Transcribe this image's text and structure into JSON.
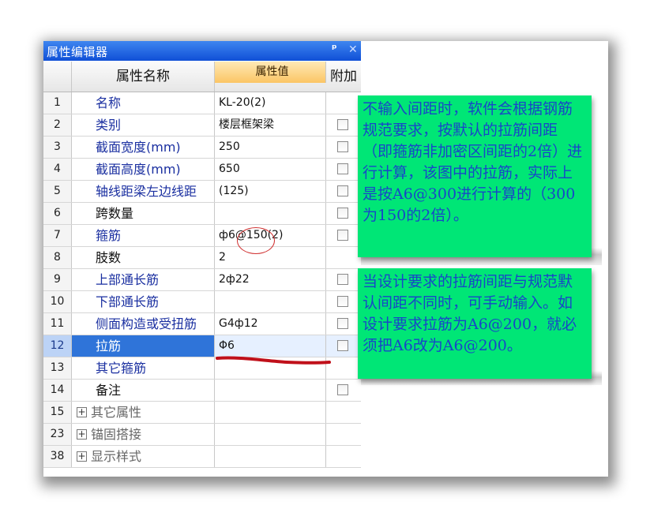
{
  "window": {
    "title": "属性编辑器",
    "pin_icon": "pin-icon",
    "close_icon": "close-icon"
  },
  "headers": {
    "name": "属性名称",
    "value": "属性值",
    "add": "附加"
  },
  "rows": [
    {
      "num": "1",
      "name": "名称",
      "value": "KL-20(2)",
      "checkbox": false
    },
    {
      "num": "2",
      "name": "类别",
      "value": "楼层框架梁",
      "checkbox": true
    },
    {
      "num": "3",
      "name": "截面宽度(mm)",
      "value": "250",
      "checkbox": true
    },
    {
      "num": "4",
      "name": "截面高度(mm)",
      "value": "650",
      "checkbox": true
    },
    {
      "num": "5",
      "name": "轴线距梁左边线距",
      "value": "(125)",
      "checkbox": true
    },
    {
      "num": "6",
      "name": "跨数量",
      "value": "",
      "checkbox": true
    },
    {
      "num": "7",
      "name": "箍筋",
      "value": "ф6@150(2)",
      "checkbox": true
    },
    {
      "num": "8",
      "name": "肢数",
      "value": "2",
      "checkbox": false
    },
    {
      "num": "9",
      "name": "上部通长筋",
      "value": "2ф22",
      "checkbox": true
    },
    {
      "num": "10",
      "name": "下部通长筋",
      "value": "",
      "checkbox": true
    },
    {
      "num": "11",
      "name": "侧面构造或受扭筋",
      "value": "G4ф12",
      "checkbox": true
    },
    {
      "num": "12",
      "name": "拉筋",
      "value": "Φ6",
      "checkbox": true
    },
    {
      "num": "13",
      "name": "其它箍筋",
      "value": "",
      "checkbox": false
    },
    {
      "num": "14",
      "name": "备注",
      "value": "",
      "checkbox": true
    },
    {
      "num": "15",
      "name": "其它属性",
      "value": "",
      "checkbox": false
    },
    {
      "num": "23",
      "name": "锚固搭接",
      "value": "",
      "checkbox": false
    },
    {
      "num": "38",
      "name": "显示样式",
      "value": "",
      "checkbox": false
    }
  ],
  "expand_icon": "plus-expand-icon",
  "notes": {
    "note1": "不输入间距时，软件会根据钢筋规范要求，按默认的拉筋间距（即箍筋非加密区间距的2倍）进行计算，该图中的拉筋，实际上是按A6@300进行计算的（300为150的2倍）。",
    "note2": "当设计要求的拉筋间距与规范默认间距不同时，可手动输入。如设计要求拉筋为A6@200，就必须把A6改为A6@200。"
  },
  "colors": {
    "titlebar": "#1f5fe0",
    "selected_row": "#2f74d9",
    "note_background": "#00e676",
    "note_text": "#1846c8",
    "annotation_red": "#c0101a"
  }
}
